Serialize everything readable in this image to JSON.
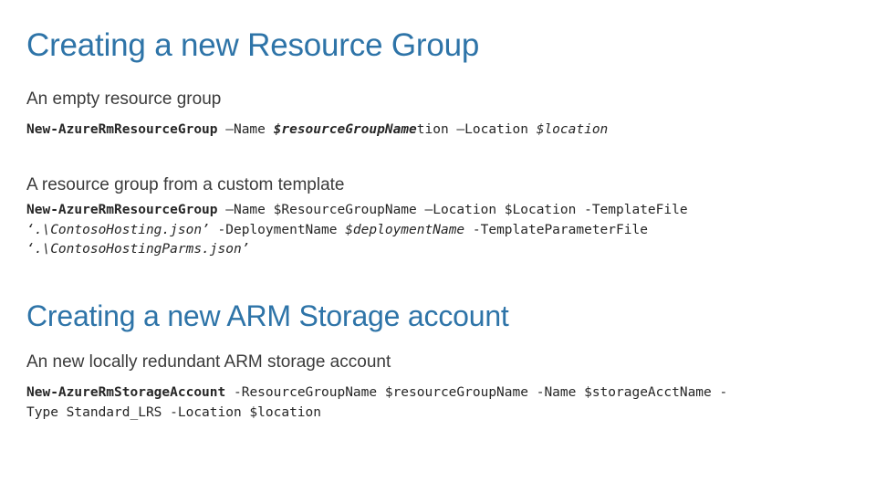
{
  "slide": {
    "background_color": "#FFFFFF",
    "accent_color": "#2E74A8",
    "body_text_color": "#3B3B3B",
    "code_text_color": "#262626"
  },
  "sections": [
    {
      "title": "Creating a new Resource Group",
      "blocks": [
        {
          "heading": "An empty resource group",
          "code_lines": [
            [
              {
                "text": "New-AzureRmResourceGroup",
                "style": "cmd"
              },
              {
                "text": " –Name ",
                "style": "plain"
              },
              {
                "text": "$resourceGroupName",
                "style": "bi"
              },
              {
                "text": "tion",
                "style": "plain"
              },
              {
                "text": " –Location ",
                "style": "plain"
              },
              {
                "text": "$location",
                "style": "ital"
              }
            ]
          ]
        },
        {
          "heading": "A resource group from a custom template",
          "code_lines": [
            [
              {
                "text": "New-AzureRmResourceGroup",
                "style": "cmd"
              },
              {
                "text": " –Name $ResourceGroupName –Location $Location -TemplateFile",
                "style": "plain"
              }
            ],
            [
              {
                "text": "‘.\\ContosoHosting.json’",
                "style": "ital"
              },
              {
                "text": " -DeploymentName ",
                "style": "plain"
              },
              {
                "text": "$deploymentName",
                "style": "ital"
              },
              {
                "text": " -TemplateParameterFile",
                "style": "plain"
              }
            ],
            [
              {
                "text": "‘.\\ContosoHostingParms.json’",
                "style": "ital"
              }
            ]
          ]
        }
      ]
    },
    {
      "title": "Creating a new ARM Storage account",
      "blocks": [
        {
          "heading": "An new locally redundant ARM storage account",
          "code_lines": [
            [
              {
                "text": "New-AzureRmStorageAccount",
                "style": "cmd"
              },
              {
                "text": " -ResourceGroupName $resourceGroupName -Name $storageAcctName -",
                "style": "plain"
              }
            ],
            [
              {
                "text": "Type Standard_LRS -Location $location",
                "style": "plain"
              }
            ]
          ]
        }
      ]
    }
  ]
}
